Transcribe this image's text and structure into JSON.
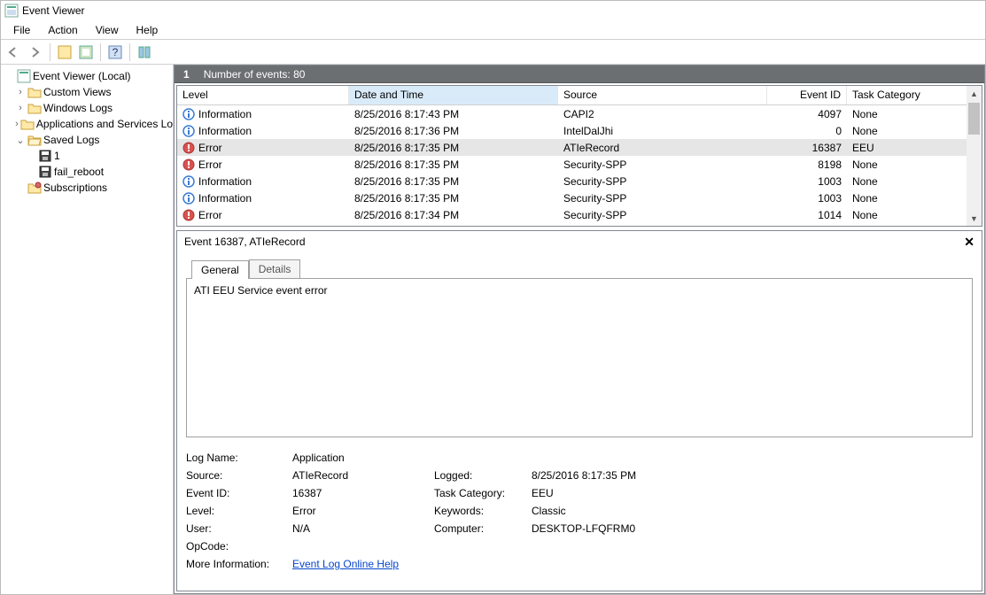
{
  "title": "Event Viewer",
  "menus": [
    "File",
    "Action",
    "View",
    "Help"
  ],
  "tree": {
    "root": "Event Viewer (Local)",
    "items": [
      {
        "label": "Custom Views",
        "expand": ">"
      },
      {
        "label": "Windows Logs",
        "expand": ">"
      },
      {
        "label": "Applications and Services Lo",
        "expand": ">"
      },
      {
        "label": "Saved Logs",
        "expand": "v",
        "children": [
          {
            "label": "1",
            "icon": "save"
          },
          {
            "label": "fail_reboot",
            "icon": "save"
          }
        ]
      },
      {
        "label": "Subscriptions",
        "icon": "sub"
      }
    ]
  },
  "countbar": {
    "badge": "1",
    "text": "Number of events: 80"
  },
  "columns": {
    "level": "Level",
    "date": "Date and Time",
    "source": "Source",
    "id": "Event ID",
    "cat": "Task Category"
  },
  "rows": [
    {
      "icon": "info",
      "level": "Information",
      "date": "8/25/2016 8:17:43 PM",
      "source": "CAPI2",
      "id": "4097",
      "cat": "None"
    },
    {
      "icon": "info",
      "level": "Information",
      "date": "8/25/2016 8:17:36 PM",
      "source": "IntelDalJhi",
      "id": "0",
      "cat": "None"
    },
    {
      "icon": "error",
      "level": "Error",
      "date": "8/25/2016 8:17:35 PM",
      "source": "ATIeRecord",
      "id": "16387",
      "cat": "EEU",
      "sel": true
    },
    {
      "icon": "error",
      "level": "Error",
      "date": "8/25/2016 8:17:35 PM",
      "source": "Security-SPP",
      "id": "8198",
      "cat": "None"
    },
    {
      "icon": "info",
      "level": "Information",
      "date": "8/25/2016 8:17:35 PM",
      "source": "Security-SPP",
      "id": "1003",
      "cat": "None"
    },
    {
      "icon": "info",
      "level": "Information",
      "date": "8/25/2016 8:17:35 PM",
      "source": "Security-SPP",
      "id": "1003",
      "cat": "None"
    },
    {
      "icon": "error",
      "level": "Error",
      "date": "8/25/2016 8:17:34 PM",
      "source": "Security-SPP",
      "id": "1014",
      "cat": "None"
    }
  ],
  "event": {
    "title": "Event 16387, ATIeRecord",
    "tabs": {
      "general": "General",
      "details": "Details"
    },
    "description": "ATI EEU Service event error",
    "props": {
      "logname_l": "Log Name:",
      "logname_v": "Application",
      "source_l": "Source:",
      "source_v": "ATIeRecord",
      "logged_l": "Logged:",
      "logged_v": "8/25/2016 8:17:35 PM",
      "eventid_l": "Event ID:",
      "eventid_v": "16387",
      "taskcat_l": "Task Category:",
      "taskcat_v": "EEU",
      "level_l": "Level:",
      "level_v": "Error",
      "keywords_l": "Keywords:",
      "keywords_v": "Classic",
      "user_l": "User:",
      "user_v": "N/A",
      "computer_l": "Computer:",
      "computer_v": "DESKTOP-LFQFRM0",
      "opcode_l": "OpCode:",
      "more_l": "More Information:",
      "more_link": "Event Log Online Help"
    }
  }
}
